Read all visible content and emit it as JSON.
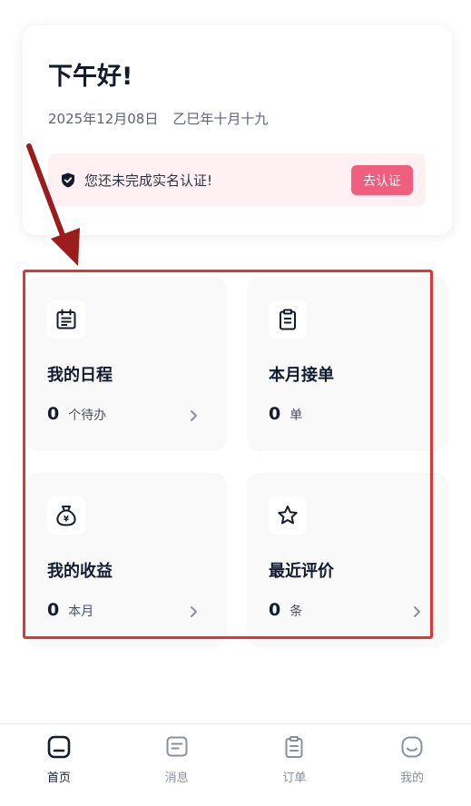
{
  "greeting": {
    "title": "下午好!",
    "date": "2025年12月08日",
    "lunar_date": "乙巳年十月十九",
    "verify_notice": "您还未完成实名认证!",
    "verify_button": "去认证"
  },
  "tiles": [
    {
      "title": "我的日程",
      "count": "0",
      "unit": "个待办",
      "icon": "calendar-icon",
      "has_chevron": true
    },
    {
      "title": "本月接单",
      "count": "0",
      "unit": "单",
      "icon": "clipboard-icon",
      "has_chevron": false
    },
    {
      "title": "我的收益",
      "count": "0",
      "unit": "本月",
      "icon": "money-bag-icon",
      "has_chevron": true
    },
    {
      "title": "最近评价",
      "count": "0",
      "unit": "条",
      "icon": "star-icon",
      "has_chevron": true
    }
  ],
  "tabbar": [
    {
      "label": "首页",
      "icon": "home-icon",
      "active": true
    },
    {
      "label": "消息",
      "icon": "message-icon",
      "active": false
    },
    {
      "label": "订单",
      "icon": "order-icon",
      "active": false
    },
    {
      "label": "我的",
      "icon": "profile-icon",
      "active": false
    }
  ],
  "colors": {
    "accent_pink": "#ef5f7d",
    "notice_bg": "#fff1f3",
    "highlight_red": "#e03636",
    "arrow_red": "#9b1c1c"
  }
}
